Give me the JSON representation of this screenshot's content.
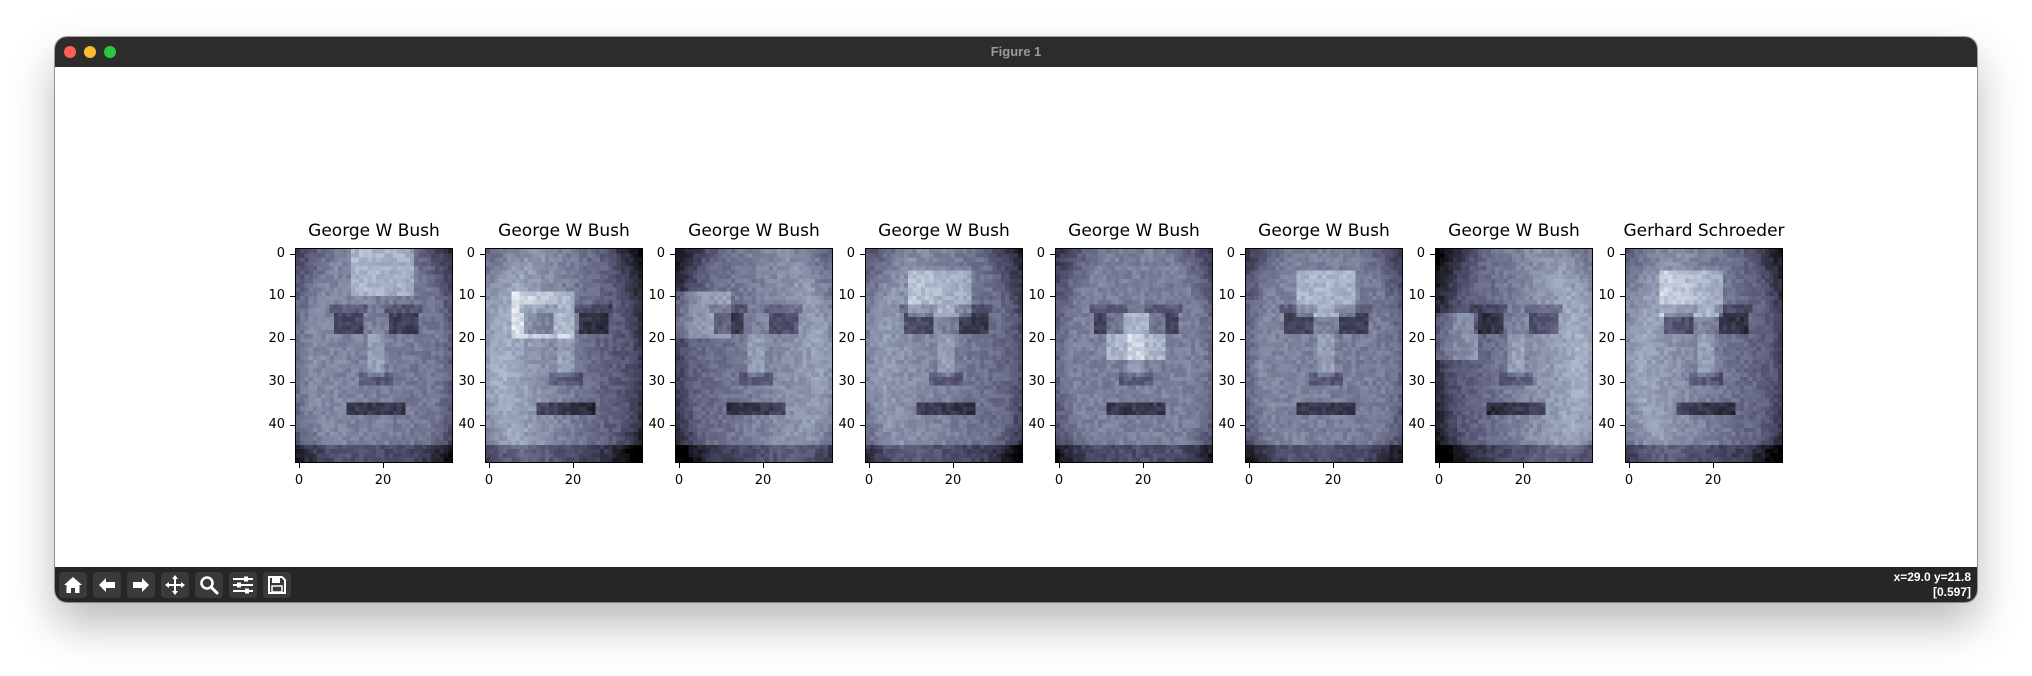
{
  "window": {
    "title": "Figure 1"
  },
  "panels": [
    {
      "title": "George W Bush"
    },
    {
      "title": "George W Bush"
    },
    {
      "title": "George W Bush"
    },
    {
      "title": "George W Bush"
    },
    {
      "title": "George W Bush"
    },
    {
      "title": "George W Bush"
    },
    {
      "title": "George W Bush"
    },
    {
      "title": "Gerhard Schroeder"
    }
  ],
  "axes": {
    "y_ticks": [
      "0",
      "10",
      "20",
      "30",
      "40"
    ],
    "x_ticks": [
      "0",
      "20"
    ]
  },
  "colormap": "bone",
  "toolbar": {
    "buttons": [
      {
        "icon": "home-icon"
      },
      {
        "icon": "back-arrow-icon"
      },
      {
        "icon": "forward-arrow-icon"
      },
      {
        "icon": "pan-move-icon"
      },
      {
        "icon": "zoom-magnifier-icon"
      },
      {
        "icon": "configure-subplots-icon"
      },
      {
        "icon": "save-floppy-icon"
      }
    ],
    "coords_line1": "x=29.0 y=21.8",
    "coords_line2": "[0.597]"
  }
}
